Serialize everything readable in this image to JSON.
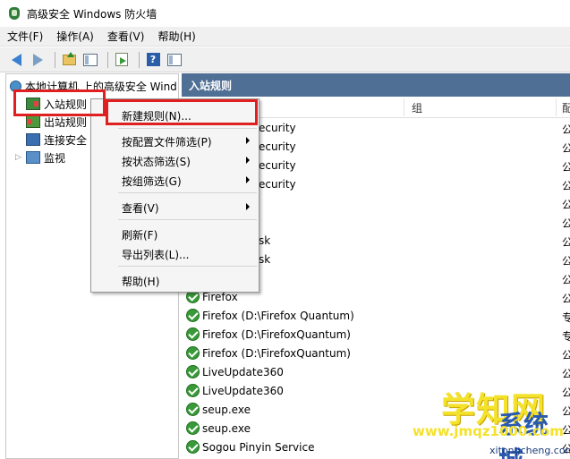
{
  "window": {
    "title": "高级安全 Windows 防火墙"
  },
  "menubar": {
    "items": [
      "文件(F)",
      "操作(A)",
      "查看(V)",
      "帮助(H)"
    ]
  },
  "toolbar": {
    "help_label": "?"
  },
  "tree": {
    "root": "本地计算机 上的高级安全 Wind",
    "items": [
      "入站规则",
      "出站规则",
      "连接安全",
      "监视"
    ]
  },
  "rules_pane": {
    "header": "入站规则",
    "columns": [
      "组",
      "配"
    ],
    "rows": [
      {
        "name": "",
        "suffix": "ecurity",
        "profile": "公"
      },
      {
        "name": "",
        "suffix": "ecurity",
        "profile": "公"
      },
      {
        "name": "",
        "suffix": "ecurity",
        "profile": "公"
      },
      {
        "name": "",
        "suffix": "ecurity",
        "profile": "公"
      },
      {
        "name": "",
        "suffix": "",
        "profile": "公"
      },
      {
        "name": "",
        "suffix": "",
        "profile": "公"
      },
      {
        "name": "",
        "suffix": "sk",
        "profile": "公"
      },
      {
        "name": "",
        "suffix": "sk",
        "profile": "公"
      },
      {
        "name": "",
        "suffix": "",
        "profile": "公"
      },
      {
        "name": "Firefox",
        "suffix": "",
        "profile": "公"
      },
      {
        "name": "Firefox (D:\\Firefox Quantum)",
        "suffix": "",
        "profile": "专"
      },
      {
        "name": "Firefox (D:\\FirefoxQuantum)",
        "suffix": "",
        "profile": "专"
      },
      {
        "name": "Firefox (D:\\FirefoxQuantum)",
        "suffix": "",
        "profile": "公"
      },
      {
        "name": "LiveUpdate360",
        "suffix": "",
        "profile": "公"
      },
      {
        "name": "LiveUpdate360",
        "suffix": "",
        "profile": "公"
      },
      {
        "name": "seup.exe",
        "suffix": "",
        "profile": "公"
      },
      {
        "name": "seup.exe",
        "suffix": "",
        "profile": "公"
      },
      {
        "name": "Sogou Pinyin Service",
        "suffix": "",
        "profile": "公"
      }
    ]
  },
  "context_menu": {
    "items": [
      {
        "label": "新建规则(N)...",
        "submenu": false
      },
      {
        "label": "按配置文件筛选(P)",
        "submenu": true
      },
      {
        "label": "按状态筛选(S)",
        "submenu": true
      },
      {
        "label": "按组筛选(G)",
        "submenu": true
      },
      {
        "label": "查看(V)",
        "submenu": true
      },
      {
        "label": "刷新(F)",
        "submenu": false
      },
      {
        "label": "导出列表(L)...",
        "submenu": false
      },
      {
        "label": "帮助(H)",
        "submenu": false
      }
    ]
  },
  "watermark": {
    "big": "学知网",
    "cheng": "系统城",
    "url": "www.jmqz1000.com",
    "sub": "xitongcheng.com"
  },
  "colors": {
    "header_blue": "#4f6f95",
    "highlight_red": "#e02020",
    "check_green": "#3a9a3a"
  }
}
